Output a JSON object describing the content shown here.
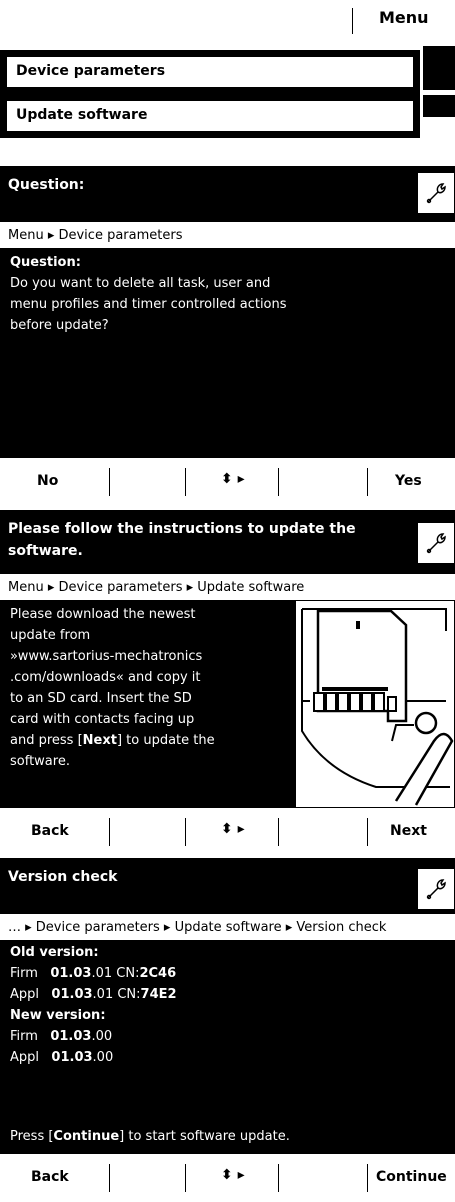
{
  "top_bar": {
    "menu_label": "Menu"
  },
  "list": {
    "item1": "Device parameters",
    "item2": "Update software"
  },
  "screen1": {
    "title": "Question:",
    "breadcrumb": "Menu ▸ Device parameters",
    "question_label": "Question:",
    "question_lines": [
      "Do you want to delete all task, user and",
      "menu profiles and timer controlled actions",
      "before update?"
    ],
    "footer": {
      "left": "No",
      "nav": "⬍ ▸",
      "right": "Yes"
    }
  },
  "screen2": {
    "title_lines": [
      "Please follow the instructions to update the",
      "software."
    ],
    "breadcrumb": "Menu ▸ Device parameters ▸ Update software",
    "instruction_lines": [
      "Please download the newest",
      "update from",
      "»www.sartorius-mechatronics",
      ".com/downloads« and copy it",
      "to an SD card. Insert the SD",
      "card with contacts facing up",
      "and press [",
      "Next",
      "] to update the",
      "software."
    ],
    "footer": {
      "left": "Back",
      "nav": "⬍ ▸",
      "right": "Next"
    }
  },
  "screen3": {
    "title": "Version check",
    "breadcrumb": "…  ▸ Device parameters ▸ Update software ▸ Version check",
    "old_label": "Old version:",
    "old_firm": {
      "k": "Firm",
      "b": "01.03",
      "r": ".01 CN:",
      "cn": "2C46"
    },
    "old_appl": {
      "k": "Appl",
      "b": "01.03",
      "r": ".01 CN:",
      "cn": "74E2"
    },
    "new_label": "New version:",
    "new_firm": {
      "k": "Firm",
      "b": "01.03",
      "r": ".00"
    },
    "new_appl": {
      "k": "Appl",
      "b": "01.03",
      "r": ".00"
    },
    "press_pre": "Press [",
    "press_bold": "Continue",
    "press_post": "] to start software update.",
    "footer": {
      "left": "Back",
      "nav": "⬍ ▸",
      "right": "Continue"
    }
  }
}
